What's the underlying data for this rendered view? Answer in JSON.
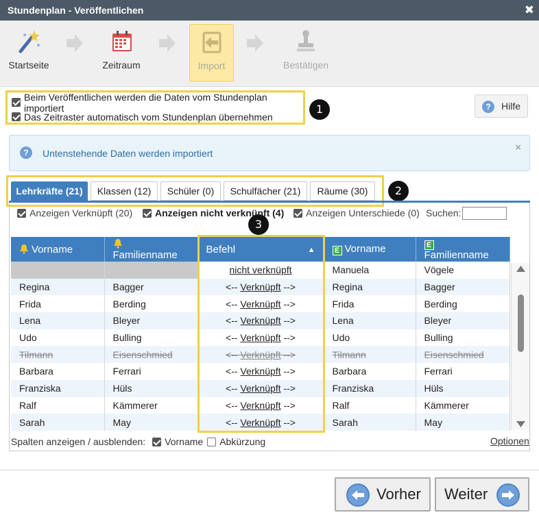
{
  "window": {
    "title": "Stundenplan - Veröffentlichen",
    "close": "✖"
  },
  "wizard": {
    "steps": [
      {
        "label": "Startseite",
        "icon": "wand-icon",
        "state": "normal"
      },
      {
        "label": "Zeitraum",
        "icon": "calendar-icon",
        "state": "normal"
      },
      {
        "label": "Import",
        "icon": "import-icon",
        "state": "active"
      },
      {
        "label": "Bestätigen",
        "icon": "stamp-icon",
        "state": "disabled"
      }
    ]
  },
  "options": {
    "import_data": {
      "label": "Beim Veröffentlichen werden die Daten vom Stundenplan importiert",
      "checked": true
    },
    "time_grid": {
      "label": "Das Zeitraster automatisch vom Stundenplan übernehmen",
      "checked": true
    }
  },
  "badges": {
    "one": "1",
    "two": "2",
    "three": "3"
  },
  "help": {
    "label": "Hilfe",
    "icon": "?"
  },
  "info": {
    "text": "Untenstehende Daten werden importiert",
    "icon": "?",
    "close": "×"
  },
  "tabs": [
    {
      "label": "Lehrkräfte (21)",
      "active": true
    },
    {
      "label": "Klassen (12)",
      "active": false
    },
    {
      "label": "Schüler (0)",
      "active": false
    },
    {
      "label": "Schulfächer (21)",
      "active": false
    },
    {
      "label": "Räume (30)",
      "active": false
    }
  ],
  "filters": {
    "linked": {
      "label": "Anzeigen Verknüpft (20)",
      "checked": true
    },
    "unlinked": {
      "label": "Anzeigen nicht verknüpft (4)",
      "checked": true
    },
    "diff": {
      "label": "Anzeigen Unterschiede (0)",
      "checked": true
    },
    "search_label": "Suchen:",
    "search_value": ""
  },
  "table": {
    "headers": {
      "vorname_left": "Vorname",
      "familienname_left": "Familienname",
      "befehl": "Befehl",
      "sort_indicator": "▲",
      "vorname_right": "Vorname",
      "familienname_right": "Familienname",
      "e_icon": "E"
    },
    "unlinked_row": {
      "befehl": "nicht verknüpft",
      "vorname_right": "Manuela",
      "familienname_right": "Vögele"
    },
    "link_prefix": "<--",
    "link_text": "Verknüpft",
    "link_suffix": "-->",
    "rows": [
      {
        "vl": "Regina",
        "fl": "Bagger",
        "vr": "Regina",
        "fr": "Bagger",
        "strike": false
      },
      {
        "vl": "Frida",
        "fl": "Berding",
        "vr": "Frida",
        "fr": "Berding",
        "strike": false
      },
      {
        "vl": "Lena",
        "fl": "Bleyer",
        "vr": "Lena",
        "fr": "Bleyer",
        "strike": false
      },
      {
        "vl": "Udo",
        "fl": "Bulling",
        "vr": "Udo",
        "fr": "Bulling",
        "strike": false
      },
      {
        "vl": "Tilmann",
        "fl": "Eisenschmied",
        "vr": "Tilmann",
        "fr": "Eisenschmied",
        "strike": true
      },
      {
        "vl": "Barbara",
        "fl": "Ferrari",
        "vr": "Barbara",
        "fr": "Ferrari",
        "strike": false
      },
      {
        "vl": "Franziska",
        "fl": "Hüls",
        "vr": "Franziska",
        "fr": "Hüls",
        "strike": false
      },
      {
        "vl": "Ralf",
        "fl": "Kämmerer",
        "vr": "Ralf",
        "fr": "Kämmerer",
        "strike": false
      },
      {
        "vl": "Sarah",
        "fl": "May",
        "vr": "Sarah",
        "fr": "May",
        "strike": false
      }
    ]
  },
  "columns_bar": {
    "label": "Spalten anzeigen / ausblenden:",
    "vorname": {
      "label": "Vorname",
      "checked": true
    },
    "abkuerzung": {
      "label": "Abkürzung",
      "checked": false
    },
    "optionen": "Optionen"
  },
  "nav": {
    "back": "Vorher",
    "next": "Weiter"
  },
  "colors": {
    "accent": "#3f7fbf",
    "highlight": "#f0d04a",
    "titlebar": "#4b5a66"
  }
}
